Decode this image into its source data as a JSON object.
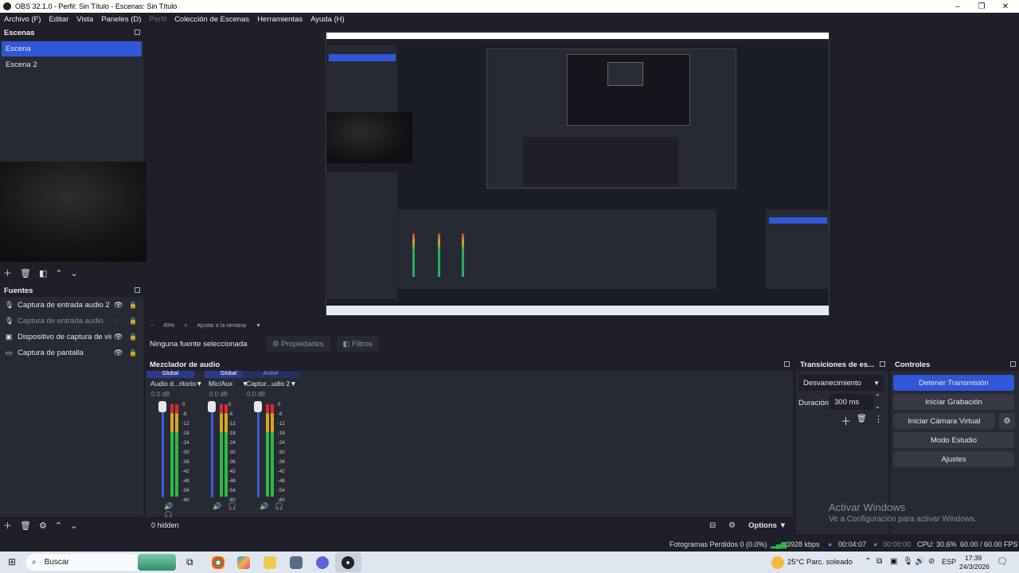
{
  "window": {
    "title": "OBS 32.1.0 - Perfil: Sin Título - Escenas: Sin Título",
    "minimize": "–",
    "maximize": "❐",
    "close": "✕"
  },
  "menu": {
    "items": [
      "Archivo (F)",
      "Editar",
      "Vista",
      "Paneles (D)",
      "Perfil",
      "Colección de Escenas",
      "Herramientas",
      "Ayuda (H)"
    ]
  },
  "scenes": {
    "title": "Escenas",
    "items": [
      "Escena",
      "Escena 2"
    ]
  },
  "sources": {
    "title": "Fuentes",
    "items": [
      {
        "label": "Captura de entrada audio 2",
        "icon": "mic-icon"
      },
      {
        "label": "Captura de entrada audio",
        "icon": "mic-icon"
      },
      {
        "label": "Dispositivo de captura de video",
        "icon": "camera-icon"
      },
      {
        "label": "Captura de pantalla",
        "icon": "monitor-icon"
      }
    ]
  },
  "zoom": {
    "value": "49%",
    "fit_label": "Ajustar a la ventana"
  },
  "source_toolbar": {
    "no_selection": "Ninguna fuente seleccionada",
    "properties": "Propiedades",
    "filters": "Filtros"
  },
  "mixer": {
    "title": "Mezclador de audio",
    "channels": [
      {
        "mode": "Global",
        "name": "Audio d...ritorio",
        "db": "0.0 dB"
      },
      {
        "mode": "Global",
        "name": "Mic/Aux",
        "db": "0.0 dB"
      },
      {
        "mode": "Active",
        "name": "Captur...udio 2",
        "db": "0.0 dB"
      }
    ],
    "scale": [
      "0",
      "-6",
      "-12",
      "-18",
      "-24",
      "-30",
      "-36",
      "-42",
      "-48",
      "-54",
      "-60"
    ],
    "hidden": "0 hidden",
    "options": "Options"
  },
  "transitions": {
    "title": "Transiciones de es...",
    "selected": "Desvanecimiento",
    "duration_label": "Duración",
    "duration_value": "300 ms"
  },
  "controls": {
    "title": "Controles",
    "buttons": [
      "Detener Transmisión",
      "Iniciar Grabación",
      "Iniciar Cámara Virtual",
      "Modo Estudio",
      "Ajustes"
    ]
  },
  "watermark": {
    "line1": "Activar Windows",
    "line2": "Ve a Configuración para activar Windows."
  },
  "status": {
    "dropped": "Fotogramas Perdidos 0 (0.0%)",
    "bitrate": "3928 kbps",
    "stream_time": "00:04:07",
    "rec_time": "00:00:00",
    "cpu": "CPU: 30.6%",
    "fps": "60.00 / 60.00 FPS"
  },
  "taskbar": {
    "search": "Buscar",
    "weather": "25°C  Parc. soleado",
    "lang": "ESP",
    "time": "17:39",
    "date": "24/3/2026"
  },
  "colors": {
    "accent": "#2f57d7",
    "panel": "#272a33",
    "background": "#1e1f29"
  }
}
